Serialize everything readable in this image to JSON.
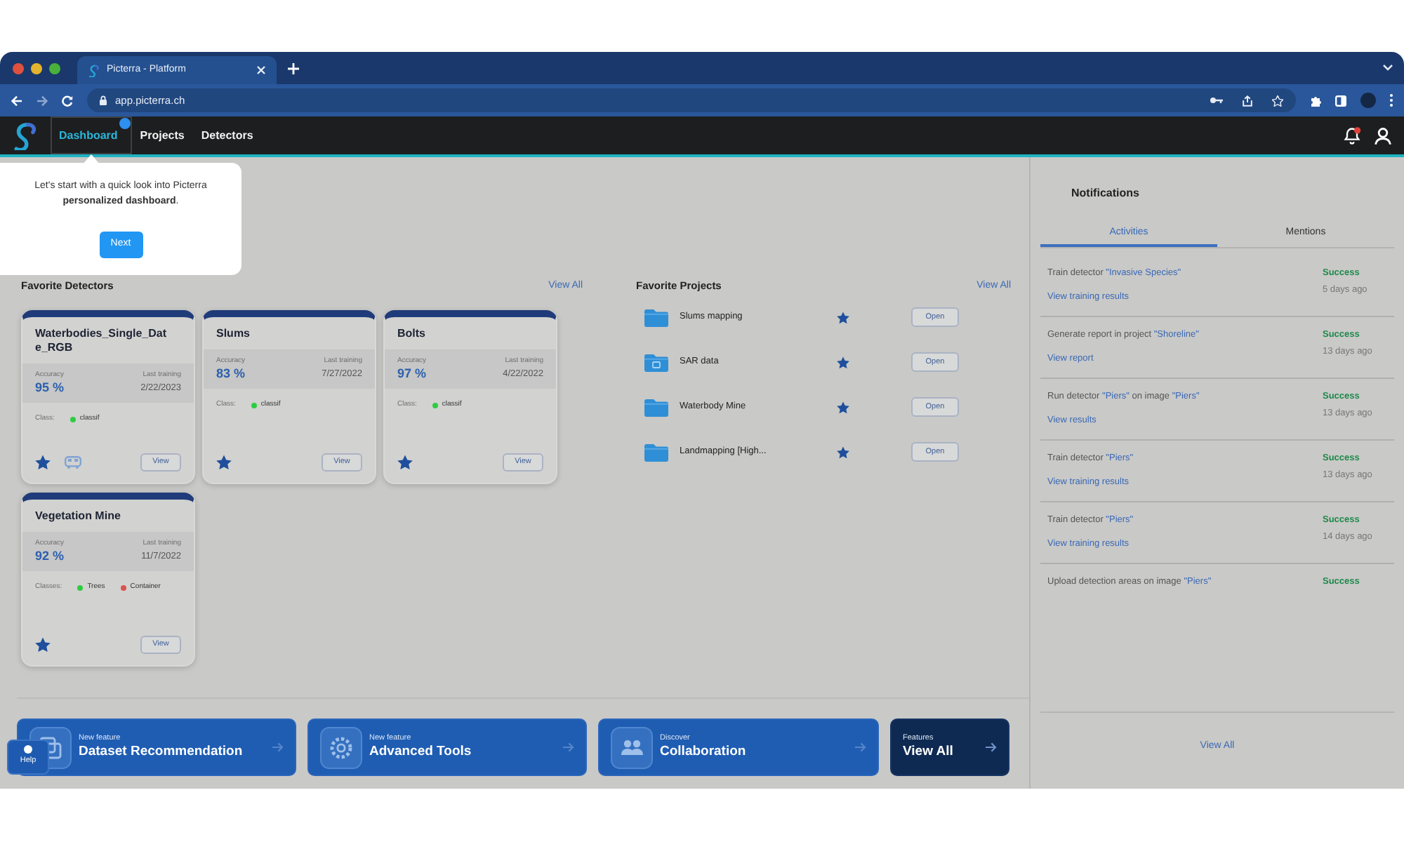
{
  "browser": {
    "tab_title": "Picterra - Platform",
    "url": "app.picterra.ch"
  },
  "navbar": {
    "items": [
      {
        "label": "Dashboard",
        "selected": true
      },
      {
        "label": "Projects",
        "selected": false
      },
      {
        "label": "Detectors",
        "selected": false
      }
    ],
    "bell_unread": true
  },
  "tour": {
    "text": "Let's start with a quick look into Picterra **personalized dashboard**.",
    "button": "Next"
  },
  "detectors": {
    "title": "Favorite Detectors",
    "view_all": "View All",
    "cards": [
      {
        "name": "Waterbodies_Single_Date_RGB",
        "accuracy_label": "Accuracy",
        "accuracy": "95 %",
        "last_training_label": "Last training",
        "last_training": "2/22/2023",
        "classes_label": "Class:",
        "classes": [
          {
            "name": "classif",
            "color": "#2ecc40"
          }
        ],
        "favorite": true,
        "secondary_icon": true,
        "button": "View"
      },
      {
        "name": "Slums",
        "accuracy_label": "Accuracy",
        "accuracy": "83 %",
        "last_training_label": "Last training",
        "last_training": "7/27/2022",
        "classes_label": "Class:",
        "classes": [
          {
            "name": "classif",
            "color": "#2ecc40"
          }
        ],
        "favorite": true,
        "secondary_icon": false,
        "button": "View"
      },
      {
        "name": "Bolts",
        "accuracy_label": "Accuracy",
        "accuracy": "97 %",
        "last_training_label": "Last training",
        "last_training": "4/22/2022",
        "classes_label": "Class:",
        "classes": [
          {
            "name": "classif",
            "color": "#2ecc40"
          }
        ],
        "favorite": true,
        "secondary_icon": false,
        "button": "View"
      },
      {
        "name": "Vegetation Mine",
        "accuracy_label": "Accuracy",
        "accuracy": "92 %",
        "last_training_label": "Last training",
        "last_training": "11/7/2022",
        "classes_label": "Classes:",
        "classes": [
          {
            "name": "Trees",
            "color": "#2ecc40"
          },
          {
            "name": "Container",
            "color": "#d9534f"
          }
        ],
        "favorite": true,
        "secondary_icon": false,
        "button": "View"
      }
    ]
  },
  "projects": {
    "title": "Favorite Projects",
    "view_all": "View All",
    "items": [
      {
        "name": "Slums mapping",
        "kind": "folder",
        "favorite": true,
        "button": "Open"
      },
      {
        "name": "SAR data",
        "kind": "tagged",
        "favorite": true,
        "button": "Open"
      },
      {
        "name": "Waterbody Mine",
        "kind": "folder",
        "favorite": true,
        "button": "Open"
      },
      {
        "name": "Landmapping [High...",
        "kind": "folder",
        "favorite": true,
        "button": "Open"
      }
    ]
  },
  "features": [
    {
      "kicker": "New feature",
      "title": "Dataset Recommendation",
      "kind": "dataset"
    },
    {
      "kicker": "New feature",
      "title": "Advanced Tools",
      "kind": "tools"
    },
    {
      "kicker": "Discover",
      "title": "Collaboration",
      "kind": "collaboration"
    },
    {
      "kicker": "Features",
      "title": "View All",
      "kind": "overview"
    }
  ],
  "help": {
    "label": "Help"
  },
  "notifications": {
    "title": "Notifications",
    "tabs": [
      {
        "label": "Activities",
        "selected": true
      },
      {
        "label": "Mentions",
        "selected": false
      }
    ],
    "items": [
      {
        "message": [
          {
            "text": "Train detector ",
            "kind": "plain"
          },
          {
            "text": "\"Invasive Species\"",
            "kind": "link"
          }
        ],
        "action": "View training results",
        "status": "Success",
        "time": "5 days ago"
      },
      {
        "message": [
          {
            "text": "Generate report in project ",
            "kind": "plain"
          },
          {
            "text": "\"Shoreline\"",
            "kind": "link"
          }
        ],
        "action": "View report",
        "status": "Success",
        "time": "13 days ago"
      },
      {
        "message": [
          {
            "text": "Run detector ",
            "kind": "plain"
          },
          {
            "text": "\"Piers\"",
            "kind": "link"
          },
          {
            "text": " on image ",
            "kind": "plain"
          },
          {
            "text": "\"Piers\"",
            "kind": "link"
          }
        ],
        "action": "View results",
        "status": "Success",
        "time": "13 days ago"
      },
      {
        "message": [
          {
            "text": "Train detector ",
            "kind": "plain"
          },
          {
            "text": "\"Piers\"",
            "kind": "link"
          }
        ],
        "action": "View training results",
        "status": "Success",
        "time": "13 days ago"
      },
      {
        "message": [
          {
            "text": "Train detector ",
            "kind": "plain"
          },
          {
            "text": "\"Piers\"",
            "kind": "link"
          }
        ],
        "action": "View training results",
        "status": "Success",
        "time": "14 days ago"
      },
      {
        "message": [
          {
            "text": "Upload detection areas on image ",
            "kind": "plain"
          },
          {
            "text": "\"Piers\"",
            "kind": "link"
          }
        ],
        "status": "Success"
      }
    ],
    "view_all": "View All"
  }
}
